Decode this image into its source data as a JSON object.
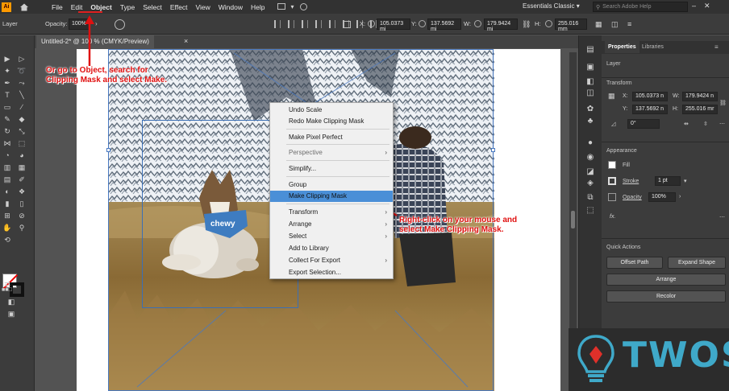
{
  "menubar": {
    "logo": "Ai",
    "items": [
      "File",
      "Edit",
      "Object",
      "Type",
      "Select",
      "Effect",
      "View",
      "Window",
      "Help"
    ],
    "workspace": "Essentials Classic",
    "search_placeholder": "Search Adobe Help"
  },
  "controlbar": {
    "layer": "Layer",
    "opacity_label": "Opacity:",
    "opacity_value": "100%",
    "x_label": "X:",
    "x_value": "105.0373 mi",
    "y_label": "Y:",
    "y_value": "137.5692 mi",
    "w_label": "W:",
    "w_value": "179.9424 mi",
    "h_label": "H:",
    "h_value": "255.016 mm"
  },
  "document_tab": {
    "title": "Untitled-2* @ 100 % (CMYK/Preview)",
    "close": "×"
  },
  "properties_panel": {
    "tabs": [
      "Properties",
      "Libraries"
    ],
    "layer_label": "Layer",
    "transform_title": "Transform",
    "x_label": "X:",
    "x_value": "105.0373 n",
    "y_label": "Y:",
    "y_value": "137.5692 n",
    "w_label": "W:",
    "w_value": "179.9424 n",
    "h_label": "H:",
    "h_value": "255.016 mr",
    "rotate_value": "0°",
    "appearance_title": "Appearance",
    "fill_label": "Fill",
    "stroke_label": "Stroke",
    "stroke_value": "1 pt",
    "opacity_label": "Opacity",
    "opacity_value": "100%",
    "fx_label": "fx.",
    "quick_actions_title": "Quick Actions",
    "buttons": [
      "Offset Path",
      "Expand Shape",
      "Arrange",
      "Recolor"
    ]
  },
  "context_menu": {
    "items": [
      {
        "label": "Undo Scale"
      },
      {
        "label": "Redo Make Clipping Mask"
      },
      {
        "label": "Make Pixel Perfect"
      },
      {
        "label": "Perspective",
        "submenu": true,
        "disabled": true
      },
      {
        "label": "Simplify..."
      },
      {
        "label": "Group"
      },
      {
        "label": "Make Clipping Mask",
        "highlight": true
      },
      {
        "label": "Transform",
        "submenu": true
      },
      {
        "label": "Arrange",
        "submenu": true
      },
      {
        "label": "Select",
        "submenu": true
      },
      {
        "label": "Add to Library"
      },
      {
        "label": "Collect For Export",
        "submenu": true
      },
      {
        "label": "Export Selection..."
      }
    ]
  },
  "annotations": {
    "top_left": [
      "Or go to Object, search for",
      "Clipping Mask and select Make."
    ],
    "right": [
      "Right-click on your mouse and",
      "select Make Clipping Mask."
    ]
  },
  "photo": {
    "bandana_text": "chewy"
  },
  "watermark": {
    "text": "TWOS"
  },
  "colors": {
    "annotation_red": "#e01010",
    "menu_highlight": "#4a8fd7",
    "watermark_blue": "#3fa9c9"
  }
}
